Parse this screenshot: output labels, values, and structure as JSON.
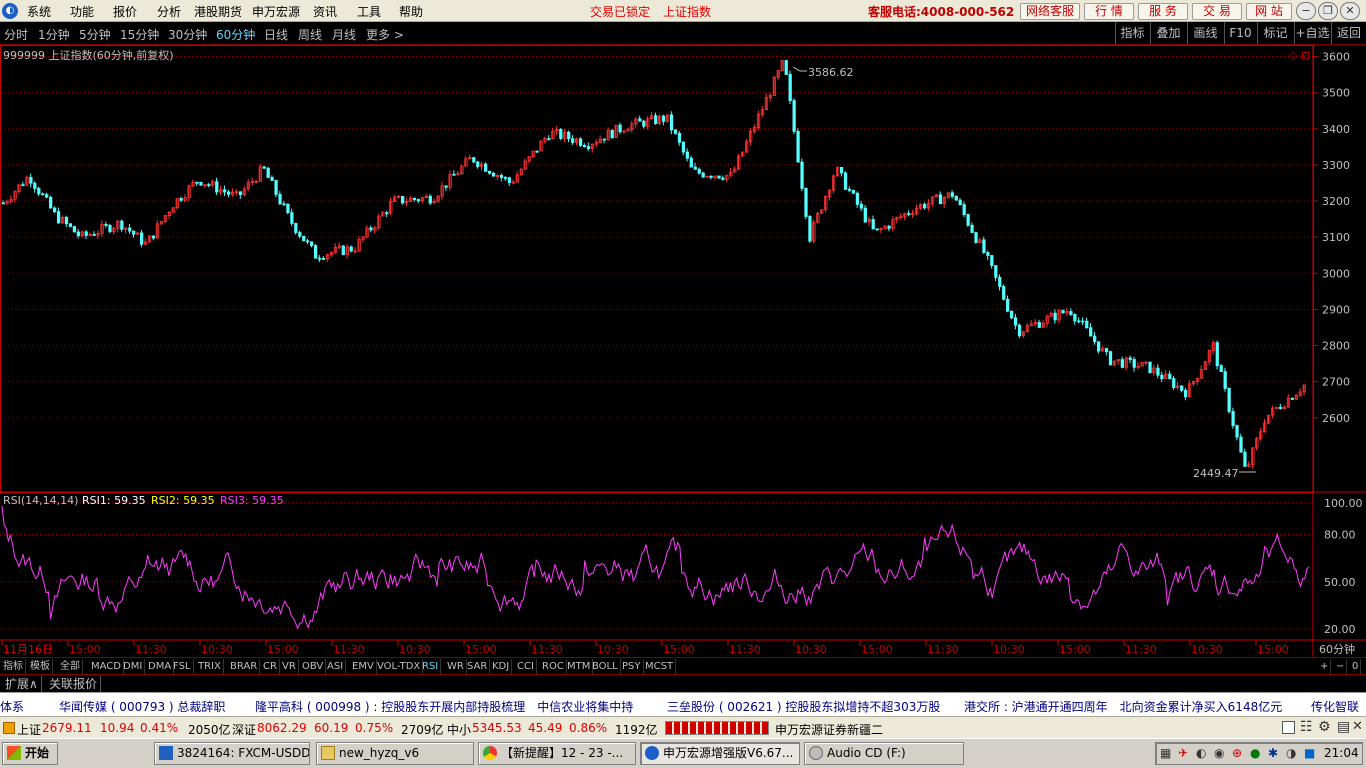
{
  "menu": {
    "items": [
      "系统",
      "功能",
      "报价",
      "分析",
      "港股期货",
      "申万宏源",
      "资讯",
      "工具",
      "帮助"
    ],
    "status_locked": "交易已锁定",
    "status_index": "上证指数",
    "hotline": "客服电话:4008-000-562",
    "right_buttons": [
      "网络客服",
      "行 情",
      "服 务",
      "交 易",
      "网 站"
    ],
    "window_controls": [
      "−",
      "❐",
      "✕"
    ]
  },
  "periods": {
    "items": [
      "分时",
      "1分钟",
      "5分钟",
      "15分钟",
      "30分钟",
      "60分钟",
      "日线",
      "周线",
      "月线",
      "更多 >"
    ],
    "active": "60分钟"
  },
  "toolbar_right": [
    "指标",
    "叠加",
    "画线",
    "F10",
    "标记",
    "+自选",
    "返回"
  ],
  "chart_title": "999999 上证指数(60分钟,前复权)",
  "indicator_title": "RSI(14,14,14)",
  "indicator_values": {
    "rsi1": "RSI1: 59.35",
    "rsi2": "RSI2: 59.35",
    "rsi3": "RSI3: 59.35"
  },
  "colors": {
    "up": "#ff3232",
    "down": "#54ffff",
    "rsi": "#ff3cff",
    "grid": "#a00000",
    "axis": "#c80000",
    "bg": "#000000"
  },
  "chart_data": [
    {
      "type": "candlestick",
      "ylim": [
        2400,
        3610
      ],
      "yticks": [
        2600,
        2700,
        2800,
        2900,
        3000,
        3100,
        3200,
        3300,
        3400,
        3500,
        3600
      ],
      "max_label": "3586.62",
      "min_label": "2449.47",
      "price_path": [
        {
          "x": 0,
          "y": 3195
        },
        {
          "x": 0.02,
          "y": 3270
        },
        {
          "x": 0.04,
          "y": 3160
        },
        {
          "x": 0.06,
          "y": 3100
        },
        {
          "x": 0.09,
          "y": 3140
        },
        {
          "x": 0.11,
          "y": 3080
        },
        {
          "x": 0.13,
          "y": 3190
        },
        {
          "x": 0.15,
          "y": 3260
        },
        {
          "x": 0.18,
          "y": 3210
        },
        {
          "x": 0.2,
          "y": 3290
        },
        {
          "x": 0.22,
          "y": 3150
        },
        {
          "x": 0.24,
          "y": 3050
        },
        {
          "x": 0.27,
          "y": 3070
        },
        {
          "x": 0.3,
          "y": 3200
        },
        {
          "x": 0.33,
          "y": 3210
        },
        {
          "x": 0.36,
          "y": 3320
        },
        {
          "x": 0.39,
          "y": 3250
        },
        {
          "x": 0.42,
          "y": 3390
        },
        {
          "x": 0.45,
          "y": 3360
        },
        {
          "x": 0.48,
          "y": 3410
        },
        {
          "x": 0.51,
          "y": 3430
        },
        {
          "x": 0.53,
          "y": 3280
        },
        {
          "x": 0.56,
          "y": 3270
        },
        {
          "x": 0.6,
          "y": 3586
        },
        {
          "x": 0.62,
          "y": 3100
        },
        {
          "x": 0.64,
          "y": 3290
        },
        {
          "x": 0.67,
          "y": 3110
        },
        {
          "x": 0.7,
          "y": 3180
        },
        {
          "x": 0.73,
          "y": 3220
        },
        {
          "x": 0.755,
          "y": 3050
        },
        {
          "x": 0.78,
          "y": 2840
        },
        {
          "x": 0.82,
          "y": 2900
        },
        {
          "x": 0.85,
          "y": 2760
        },
        {
          "x": 0.88,
          "y": 2740
        },
        {
          "x": 0.91,
          "y": 2670
        },
        {
          "x": 0.93,
          "y": 2800
        },
        {
          "x": 0.955,
          "y": 2449
        },
        {
          "x": 0.97,
          "y": 2600
        },
        {
          "x": 1,
          "y": 2690
        }
      ],
      "time_axis": [
        "11月16日",
        "15:00",
        "11:30",
        "10:30",
        "15:00",
        "11:30",
        "10:30",
        "15:00",
        "11:30",
        "10:30",
        "15:00",
        "11:30",
        "10:30",
        "15:00",
        "11:30",
        "10:30",
        "15:00",
        "11:30",
        "10:30",
        "15:00"
      ],
      "time_unit": "60分钟"
    },
    {
      "type": "line",
      "name": "RSI",
      "ylim": [
        15,
        105
      ],
      "yticks": [
        20.0,
        50.0,
        80.0,
        100.0
      ],
      "ytick_labels": [
        "20.00",
        "50.00",
        "80.00",
        "100.00"
      ],
      "last_value": 59.35
    }
  ],
  "indicator_tabs": [
    "指标",
    "模板",
    "全部",
    "MACD",
    "DMI",
    "DMA",
    "FSL",
    "TRIX",
    "BRAR",
    "CR",
    "VR",
    "OBV",
    "ASI",
    "EMV",
    "VOL-TDX",
    "RSI",
    "WR",
    "SAR",
    "KDJ",
    "CCI",
    "ROC",
    "MTM",
    "BOLL",
    "PSY",
    "MCST"
  ],
  "indicator_active": "RSI",
  "tab_controls": [
    "+",
    "−",
    "0"
  ],
  "ext_tabs": [
    "扩展∧",
    "关联报价"
  ],
  "news": [
    "体系",
    "华闻传媒 ( 000793 ) 总裁辞职",
    "隆平高科 ( 000998 ) : 控股股东开展内部持股梳理　中信农业将集中持",
    "三垒股份 ( 002621 ) 控股股东拟增持不超303万股",
    "港交所 : 沪港通开通四周年　北向资金累计净买入6148亿元",
    "传化智联"
  ],
  "indices": {
    "sh_label": "上证",
    "sh_value": "2679.11",
    "sh_change": "10.94",
    "sh_pct": "0.41%",
    "sh_amount": "2050亿",
    "sz_label": "深证",
    "sz_value": "8062.29",
    "sz_change": "60.19",
    "sz_pct": "0.75%",
    "sz_amount": "2709亿",
    "zx_label": "中小",
    "zx_value": "5345.53",
    "zx_change": "45.49",
    "zx_pct": "0.86%",
    "zx_amount": "1192亿",
    "broker_text": "申万宏源证券新疆二"
  },
  "taskbar": {
    "start": "开始",
    "tasks": [
      "3824164: FXCM-USDDe...",
      "new_hyzq_v6",
      "【新提醒】12 - 23 -...",
      "申万宏源增强版V6.67...",
      "Audio CD (F:)"
    ],
    "clock": "21:04"
  }
}
